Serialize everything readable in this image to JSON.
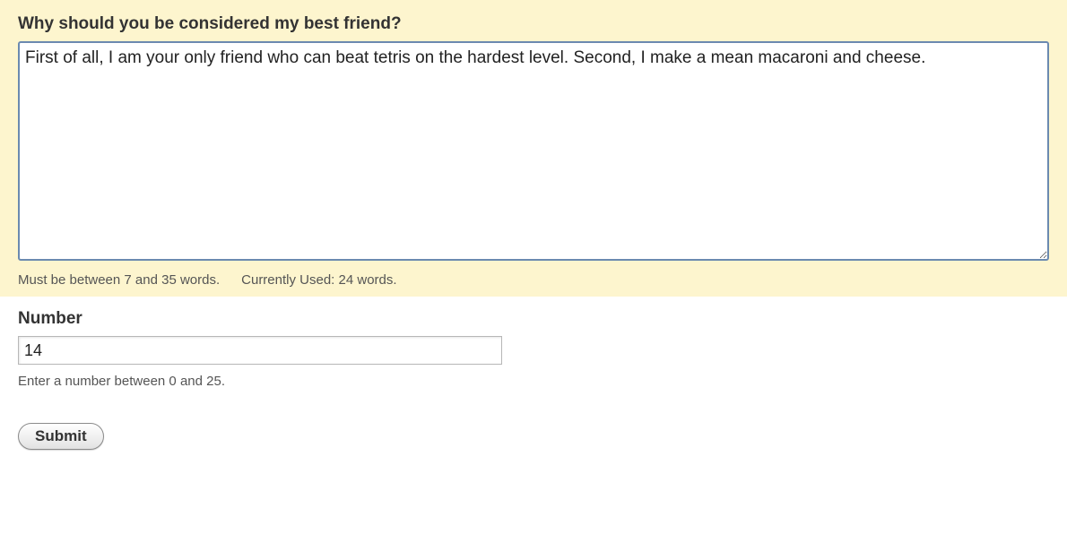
{
  "essay": {
    "label": "Why should you be considered my best friend?",
    "value": "First of all, I am your only friend who can beat tetris on the hardest level. Second, I make a mean macaroni and cheese.",
    "hint_range": "Must be between 7 and 35 words.",
    "hint_count": "Currently Used: 24 words."
  },
  "number": {
    "label": "Number",
    "value": "14",
    "hint": "Enter a number between 0 and 25."
  },
  "submit": {
    "label": "Submit"
  }
}
